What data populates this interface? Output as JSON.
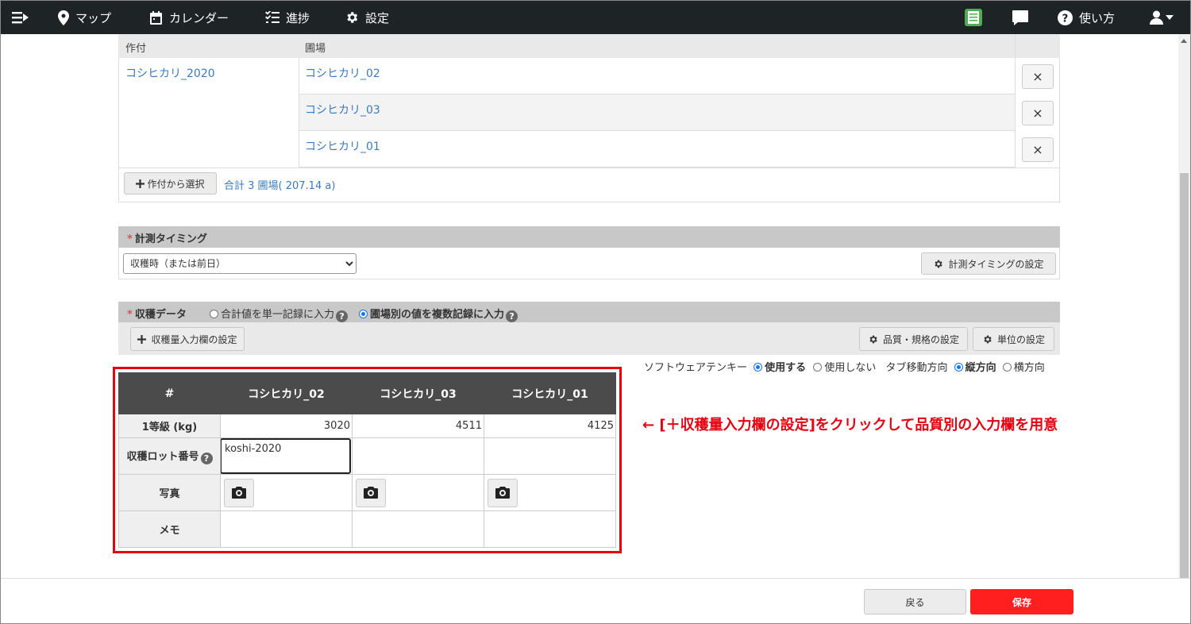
{
  "nav": {
    "map": "マップ",
    "calendar": "カレンダー",
    "progress": "進捗",
    "settings": "設定",
    "help": "使い方",
    "badge_icon": "record-book-icon",
    "accent": "#4caf50"
  },
  "fields": {
    "col_crop": "作付",
    "col_field": "圃場",
    "crop": "コシヒカリ_2020",
    "rows": [
      "コシヒカリ_02",
      "コシヒカリ_03",
      "コシヒカリ_01"
    ],
    "remove_label": "×",
    "select_from_crop": "作付から選択",
    "total": "合計 3 圃場( 207.14 a)"
  },
  "timing": {
    "title": "計測タイミング",
    "selected": "収穫時（または前日）",
    "settings_button": "計測タイミングの設定"
  },
  "harvest": {
    "title": "収穫データ",
    "option_single": "合計値を単一記録に入力",
    "option_multi": "圃場別の値を複数記録に入力",
    "input_settings": "収穫量入力欄の設定",
    "quality_settings": "品質・規格の設定",
    "unit_settings": "単位の設定",
    "tenkey_label": "ソフトウェアテンキー",
    "tenkey_on": "使用する",
    "tenkey_off": "使用しない",
    "tab_label": "タブ移動方向",
    "tab_vertical": "縦方向",
    "tab_horizontal": "横方向"
  },
  "grid": {
    "corner": "#",
    "columns": [
      "コシヒカリ_02",
      "コシヒカリ_03",
      "コシヒカリ_01"
    ],
    "row_grade": "1等級 (kg)",
    "grade_values": [
      "3020",
      "4511",
      "4125"
    ],
    "row_lot": "収穫ロット番号",
    "lot_value": "koshi-2020",
    "row_photo": "写真",
    "row_memo": "メモ"
  },
  "annotation": "← [＋収穫量入力欄の設定]をクリックして品質別の入力欄を用意",
  "footer": {
    "back": "戻る",
    "save": "保存",
    "save_color": "#ff1f1f"
  }
}
